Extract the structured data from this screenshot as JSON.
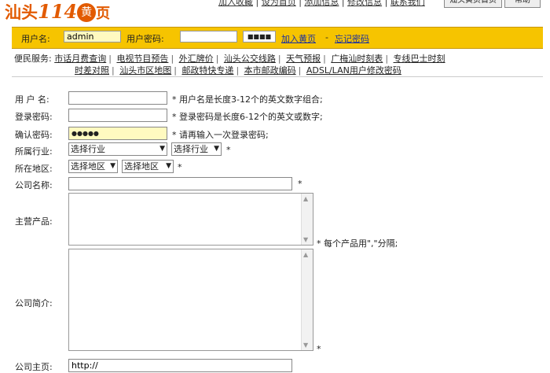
{
  "logo": {
    "text1": "汕头",
    "num": "114",
    "badge": "黄",
    "tail": "页"
  },
  "toplinks": [
    "加入收藏",
    "设为首页",
    "添加信息",
    "修改信息",
    "联系我们"
  ],
  "topbuttons": [
    "汕头黄页首页",
    "帮助"
  ],
  "login": {
    "user_label": "用户名:",
    "user_value": "admin",
    "pwd_label": "用户密码:",
    "code_value": "■■■■",
    "join_link": "加入黄页",
    "dash": "-",
    "forgot_link": "忘记密码"
  },
  "nav": {
    "row1": [
      "便民服务:",
      "市话月费查询",
      "电视节目预告",
      "外汇牌价",
      "汕头公交线路",
      "天气预报",
      "广梅汕时刻表",
      "专线巴士时刻"
    ],
    "row2": [
      "时差对照",
      "汕头市区地图",
      "邮政特快专递",
      "本市邮政编码",
      "ADSL/LAN用户修改密码"
    ]
  },
  "form": {
    "username_label": "用 户 名:",
    "username_hint": "* 用户名是长度3-12个的英文数字组合;",
    "password_label": "登录密码:",
    "password_hint": "* 登录密码是长度6-12个的英文或数字;",
    "confirm_label": "确认密码:",
    "confirm_value": "●●●●●",
    "confirm_hint": "* 请再输入一次登录密码;",
    "industry_label": "所属行业:",
    "industry_select1": "选择行业",
    "industry_select2": "选择行业",
    "region_label": "所在地区:",
    "region_select1": "选择地区",
    "region_select2": "选择地区",
    "company_label": "公司名称:",
    "products_label": "主营产品:",
    "products_hint": "* 每个产品用\",\"分隔;",
    "intro_label": "公司简介:",
    "homepage_label": "公司主页:",
    "homepage_value": "http://",
    "star": "*"
  }
}
